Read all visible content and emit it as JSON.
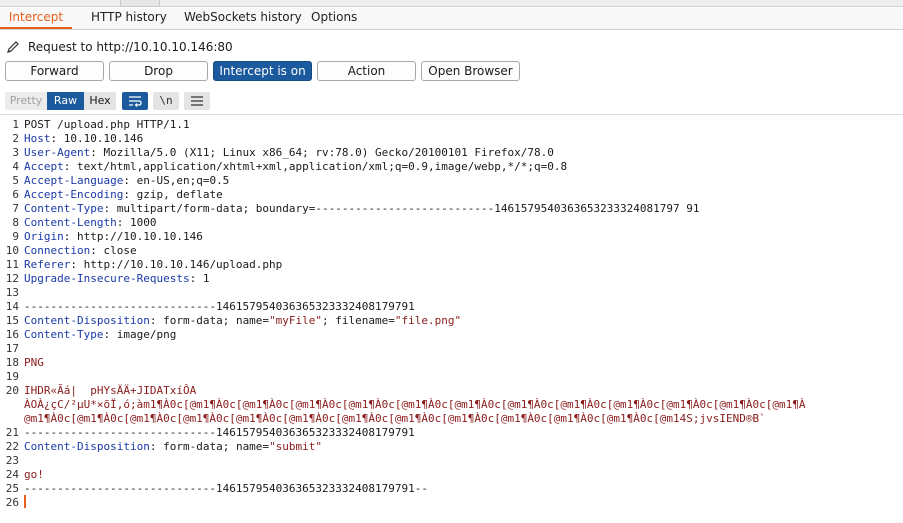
{
  "tabs": [
    {
      "label": "Intercept",
      "active": true
    },
    {
      "label": "HTTP history",
      "active": false
    },
    {
      "label": "WebSockets history",
      "active": false
    },
    {
      "label": "Options",
      "active": false
    }
  ],
  "request_target": "Request to http://10.10.10.146:80",
  "buttons": {
    "forward": "Forward",
    "drop": "Drop",
    "intercept": "Intercept is on",
    "action": "Action",
    "open_browser": "Open Browser"
  },
  "view_modes": {
    "pretty": "Pretty",
    "raw": "Raw",
    "hex": "Hex",
    "newline_label": "\\n",
    "selected": "Raw"
  },
  "colors": {
    "accent": "#e8601a",
    "selected": "#1c5a9e",
    "header_key": "#1a3aa8",
    "string_value": "#8a1c1c"
  },
  "request": {
    "request_line": "POST /upload.php HTTP/1.1",
    "headers": [
      {
        "name": "Host",
        "value": "10.10.10.146"
      },
      {
        "name": "User-Agent",
        "value": "Mozilla/5.0 (X11; Linux x86_64; rv:78.0) Gecko/20100101 Firefox/78.0"
      },
      {
        "name": "Accept",
        "value": "text/html,application/xhtml+xml,application/xml;q=0.9,image/webp,*/*;q=0.8"
      },
      {
        "name": "Accept-Language",
        "value": "en-US,en;q=0.5"
      },
      {
        "name": "Accept-Encoding",
        "value": "gzip, deflate"
      },
      {
        "name": "Content-Type",
        "value": "multipart/form-data; boundary=---------------------------1461579540363653233324081797 91"
      },
      {
        "name": "Content-Length",
        "value": "1000"
      },
      {
        "name": "Origin",
        "value": "http://10.10.10.146"
      },
      {
        "name": "Connection",
        "value": "close"
      },
      {
        "name": "Referer",
        "value": "http://10.10.10.146/upload.php"
      },
      {
        "name": "Upgrade-Insecure-Requests",
        "value": "1"
      }
    ],
    "boundary": "-----------------------------146157954036365323332408179791",
    "part1_disposition_name": "Content-Disposition",
    "part1_disposition_pre": "form-data; name=",
    "part1_field": "\"myFile\"",
    "part1_mid": "; filename=",
    "part1_filename": "\"file.png\"",
    "part1_type_name": "Content-Type",
    "part1_type_value": "image/png",
    "png_magic": "PNG",
    "binary_line1": "IHDR«Ãá|  pHYsÄÄ+JIDATxíÔA",
    "binary_line2": "ÀOÀ¿çC/²µU*×õÏ,ó;àm1¶À0c[@m1¶À0c[@m1¶À0c[@m1¶À0c[@m1¶À0c[@m1¶À0c[@m1¶À0c[@m1¶À0c[@m1¶À0c[@m1¶À0c[@m1¶À0c[@m1¶À0c[@m1¶À",
    "binary_line3": "@m1¶À0c[@m1¶À0c[@m1¶À0c[@m1¶À0c[@m1¶À0c[@m1¶À0c[@m1¶À0c[@m1¶À0c[@m1¶À0c[@m1¶À0c[@m1¶À0c[@m1¶À0c[@m14S;jvsIEND®B`",
    "part2_disposition_name": "Content-Disposition",
    "part2_disposition_pre": "form-data; name=",
    "part2_field": "\"submit\"",
    "part2_value": "go!",
    "final_boundary": "-----------------------------146157954036365323332408179791--"
  }
}
